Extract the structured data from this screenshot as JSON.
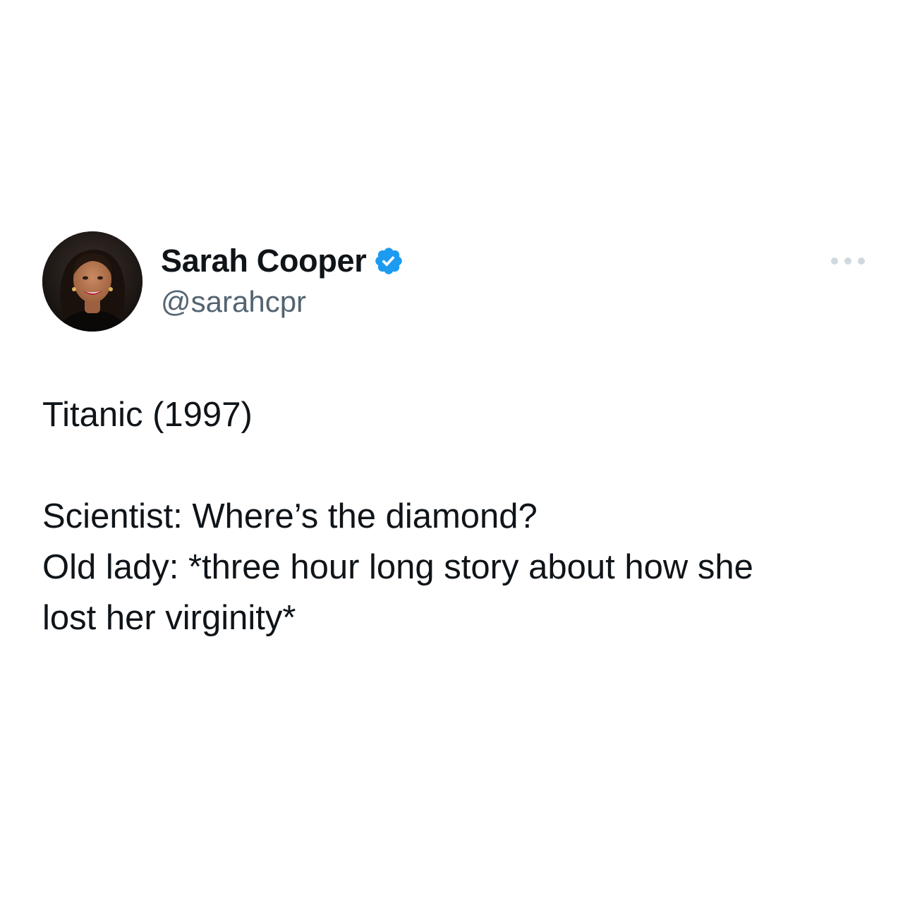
{
  "author": {
    "display_name": "Sarah Cooper",
    "handle": "@sarahcpr",
    "verified": true,
    "avatar_icon": "profile-photo",
    "verified_icon": "verified-badge-icon",
    "verified_color": "#1d9bf0"
  },
  "menu": {
    "icon": "more-options-icon"
  },
  "tweet": {
    "lines": [
      "Titanic (1997)",
      "Scientist: Where’s the diamond?",
      "Old lady: *three hour long story about how she",
      "lost her virginity*"
    ]
  },
  "colors": {
    "text": "#0f1419",
    "secondary": "#536471",
    "background": "#ffffff"
  }
}
